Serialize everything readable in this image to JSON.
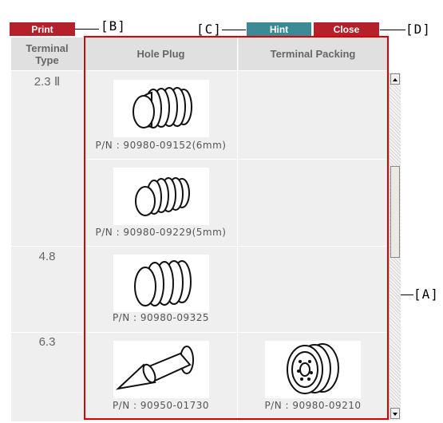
{
  "toolbar": {
    "print_label": "Print",
    "hint_label": "Hint",
    "close_label": "Close"
  },
  "callouts": {
    "b": "[B]",
    "c": "[C]",
    "d": "[D]",
    "a": "[A]"
  },
  "table": {
    "headers": {
      "terminal_type": "Terminal\nType",
      "hole_plug": "Hole Plug",
      "terminal_packing": "Terminal Packing"
    },
    "rows": [
      {
        "terminal_type": "2.3 Ⅱ",
        "hole_plug_pn": "P/N : 90980-09152(6mm)",
        "packing_pn": ""
      },
      {
        "terminal_type": "",
        "hole_plug_pn": "P/N : 90980-09229(5mm)",
        "packing_pn": ""
      },
      {
        "terminal_type": "4.8",
        "hole_plug_pn": "P/N : 90980-09325",
        "packing_pn": ""
      },
      {
        "terminal_type": "6.3",
        "hole_plug_pn": "P/N : 90950-01730",
        "packing_pn": "P/N : 90980-09210"
      }
    ]
  },
  "colors": {
    "print_button": "#b5202a",
    "hint_button": "#3c8a96",
    "close_button": "#b5202a",
    "highlight_border": "#e00000",
    "header_bg": "#e0e0e0",
    "cell_bg": "#efefef"
  },
  "icons": {
    "hole_plug_image": "ribbed-plug-icon",
    "tapered_plug_image": "tapered-plug-icon",
    "packing_image": "grommet-icon",
    "scroll_up": "arrow-up-icon",
    "scroll_down": "arrow-down-icon"
  }
}
